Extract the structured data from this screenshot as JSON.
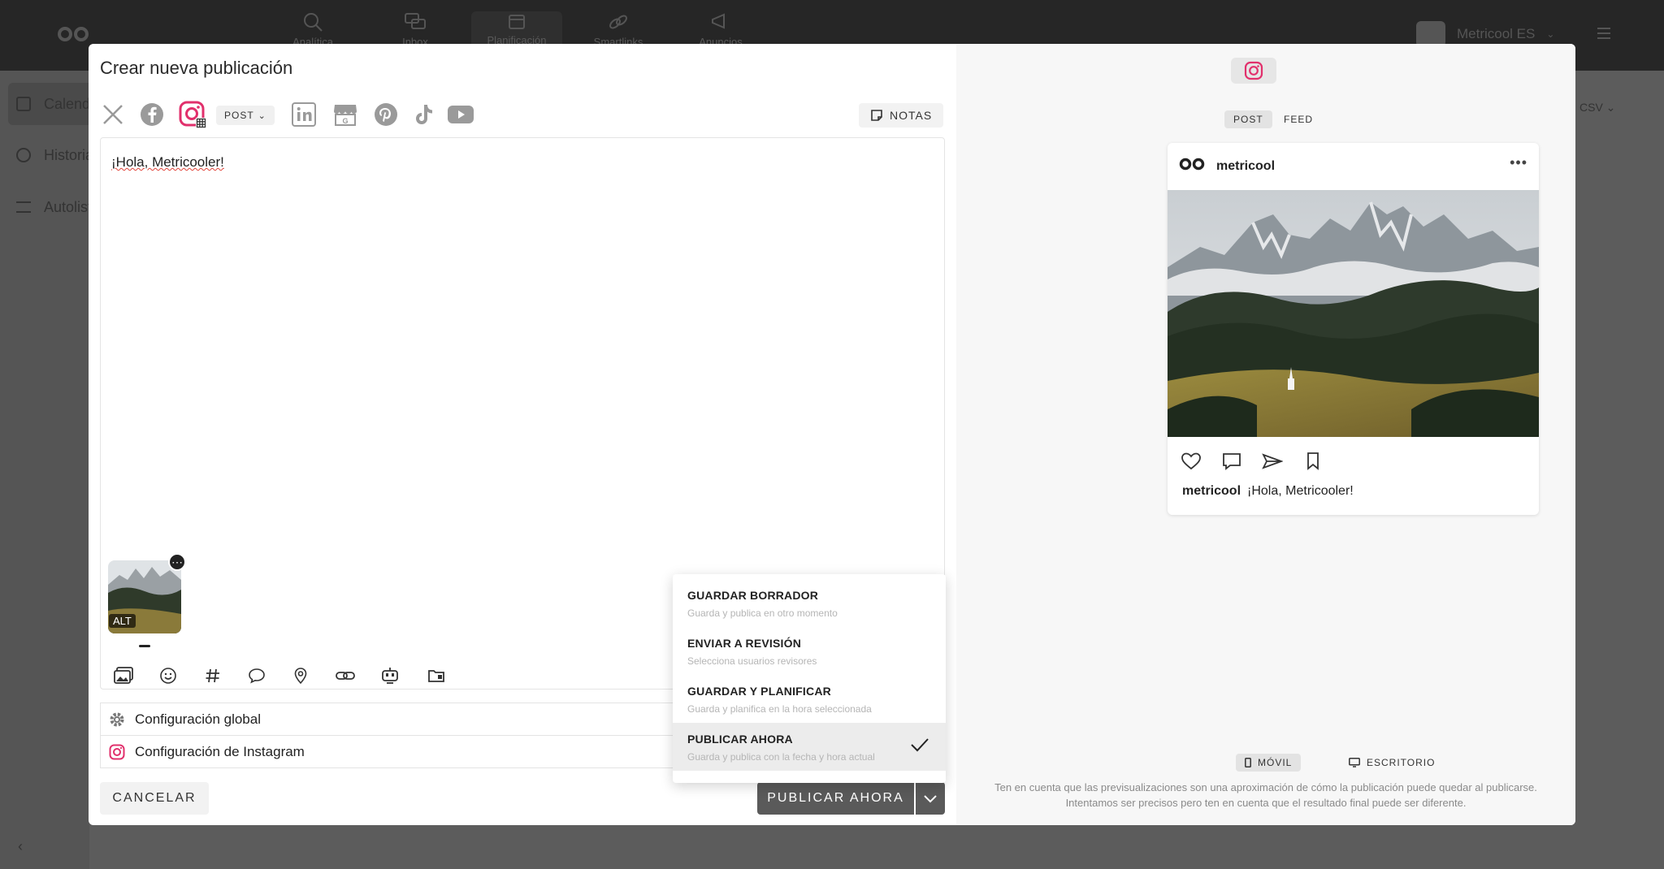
{
  "topbar": {
    "nav": [
      {
        "label": "Analítica",
        "icon": "analytics-icon"
      },
      {
        "label": "Inbox",
        "icon": "chat-icon"
      },
      {
        "label": "Planificación",
        "icon": "calendar-icon"
      },
      {
        "label": "Smartlinks",
        "icon": "link-icon"
      },
      {
        "label": "Anuncios",
        "icon": "megaphone-icon"
      }
    ],
    "account": "Metricool ES",
    "csv": "CSV"
  },
  "sidebar": {
    "items": [
      {
        "label": "Calendario",
        "icon": "calendar-icon"
      },
      {
        "label": "Historial",
        "icon": "history-icon"
      },
      {
        "label": "Autolistas",
        "icon": "list-icon"
      }
    ]
  },
  "modal": {
    "title": "Crear nueva publicación",
    "post_type": "POST",
    "notes_label": "NOTAS",
    "editor_text": "¡Hola, Metricooler!",
    "alt_label": "ALT",
    "config": [
      {
        "label": "Configuración global",
        "icon": "gear-icon"
      },
      {
        "label": "Configuración de Instagram",
        "icon": "instagram-icon"
      }
    ],
    "cancel_label": "CANCELAR",
    "publish_label": "PUBLICAR AHORA",
    "dropdown": [
      {
        "label": "GUARDAR BORRADOR",
        "desc": "Guarda y publica en otro momento"
      },
      {
        "label": "ENVIAR A REVISIÓN",
        "desc": "Selecciona usuarios revisores"
      },
      {
        "label": "GUARDAR Y PLANIFICAR",
        "desc": "Guarda y planifica en la hora seleccionada"
      },
      {
        "label": "PUBLICAR AHORA",
        "desc": "Guarda y publica con la fecha y hora actual",
        "selected": true
      }
    ]
  },
  "preview": {
    "tabs": [
      "POST",
      "FEED"
    ],
    "username": "metricool",
    "caption_user": "metricool",
    "caption_text": "¡Hola, Metricooler!",
    "device_tabs": [
      "MÓVIL",
      "ESCRITORIO"
    ],
    "disclaimer_1": "Ten en cuenta que las previsualizaciones son una aproximación de cómo la publicación puede quedar al publicarse.",
    "disclaimer_2": "Intentamos ser precisos pero ten en cuenta que el resultado final puede ser diferente."
  },
  "colors": {
    "instagram": "#e1306c",
    "dark_button": "#5a5a5a"
  }
}
